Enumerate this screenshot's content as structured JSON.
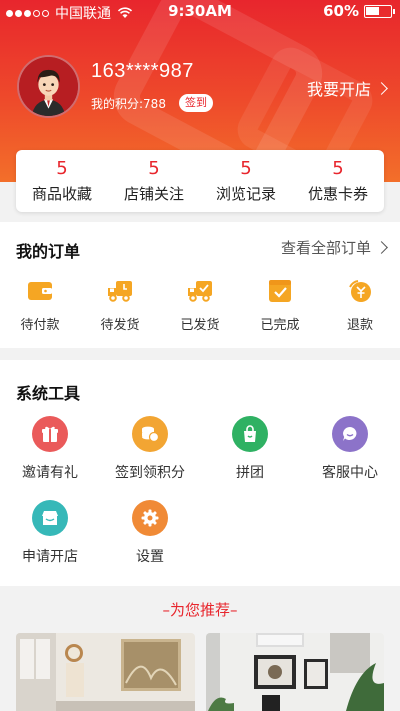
{
  "status_bar": {
    "carrier": "中国联通",
    "time": "9:30AM",
    "battery_percent": "60%",
    "battery_level": 0.6,
    "signal_bars": 5,
    "signal_active": 3
  },
  "profile": {
    "username": "163****987",
    "points_text": "我的积分:788",
    "signin_label": "签到",
    "open_store_label": "我要开店"
  },
  "stats": [
    {
      "count": "5",
      "label": "商品收藏"
    },
    {
      "count": "5",
      "label": "店铺关注"
    },
    {
      "count": "5",
      "label": "浏览记录"
    },
    {
      "count": "5",
      "label": "优惠卡券"
    }
  ],
  "orders": {
    "title": "我的订单",
    "view_all": "查看全部订单",
    "items": [
      {
        "label": "待付款",
        "icon": "wallet-icon"
      },
      {
        "label": "待发货",
        "icon": "delivery-truck-icon"
      },
      {
        "label": "已发货",
        "icon": "shipped-truck-icon"
      },
      {
        "label": "已完成",
        "icon": "completed-box-icon"
      },
      {
        "label": "退款",
        "icon": "refund-icon"
      }
    ]
  },
  "tools": {
    "title": "系统工具",
    "items": [
      {
        "label": "邀请有礼",
        "icon": "gift-icon",
        "color": "#ea5a5a"
      },
      {
        "label": "签到领积分",
        "icon": "coins-icon",
        "color": "#f2a533"
      },
      {
        "label": "拼团",
        "icon": "shopping-bag-icon",
        "color": "#2fb163"
      },
      {
        "label": "客服中心",
        "icon": "chat-icon",
        "color": "#8c73c9"
      },
      {
        "label": "申请开店",
        "icon": "store-icon",
        "color": "#36b8b8"
      },
      {
        "label": "设置",
        "icon": "gear-icon",
        "color": "#f08a36"
      }
    ]
  },
  "recommend": {
    "title": "–为您推荐–"
  },
  "colors": {
    "accent": "#e8262d",
    "header_gradient_end": "#f36f2a",
    "order_icon": "#f5a623"
  }
}
